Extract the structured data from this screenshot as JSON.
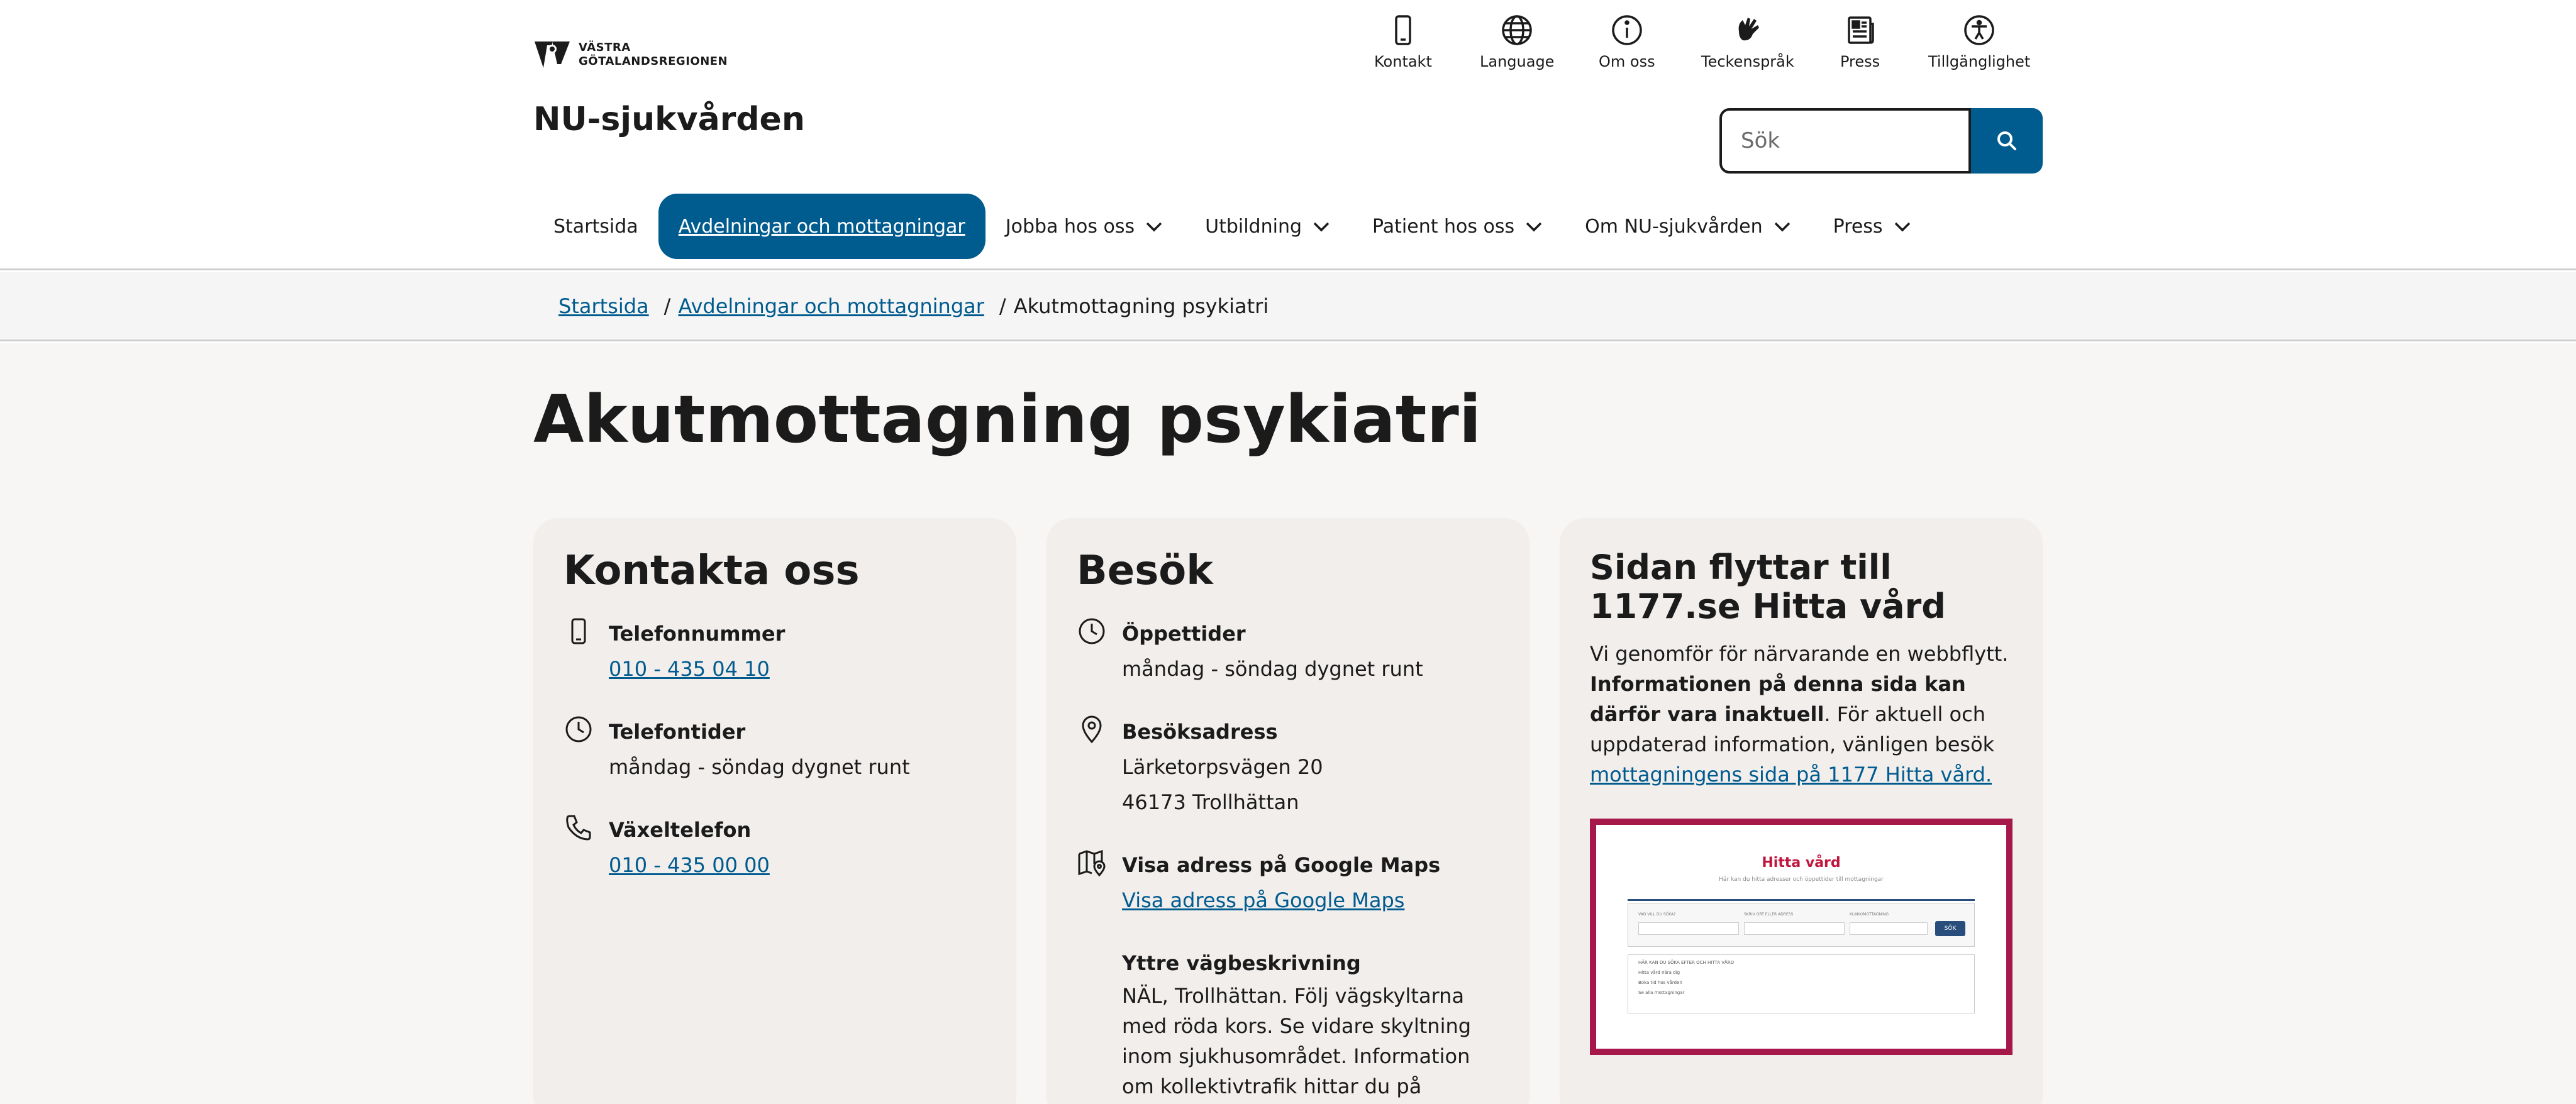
{
  "header": {
    "logo_text_line1": "VÄSTRA",
    "logo_text_line2": "GÖTALANDSREGIONEN",
    "site_title": "NU-sjukvården",
    "utility_links": [
      {
        "label": "Kontakt",
        "icon": "phone-icon"
      },
      {
        "label": "Language",
        "icon": "globe-icon"
      },
      {
        "label": "Om oss",
        "icon": "info-icon"
      },
      {
        "label": "Teckenspråk",
        "icon": "sign-language-icon"
      },
      {
        "label": "Press",
        "icon": "newspaper-icon"
      },
      {
        "label": "Tillgänglighet",
        "icon": "accessibility-icon"
      }
    ],
    "search": {
      "placeholder": "Sök",
      "value": ""
    }
  },
  "nav": [
    {
      "label": "Startsida",
      "has_dropdown": false,
      "active": false
    },
    {
      "label": "Avdelningar och mottagningar",
      "has_dropdown": false,
      "active": true
    },
    {
      "label": "Jobba hos oss",
      "has_dropdown": true,
      "active": false
    },
    {
      "label": "Utbildning",
      "has_dropdown": true,
      "active": false
    },
    {
      "label": "Patient hos oss",
      "has_dropdown": true,
      "active": false
    },
    {
      "label": "Om NU-sjukvården",
      "has_dropdown": true,
      "active": false
    },
    {
      "label": "Press",
      "has_dropdown": true,
      "active": false
    }
  ],
  "breadcrumb": {
    "items": [
      "Startsida",
      "Avdelningar och mottagningar"
    ],
    "separator": "/",
    "current": "Akutmottagning psykiatri"
  },
  "page_title": "Akutmottagning psykiatri",
  "contact_card": {
    "title": "Kontakta oss",
    "phone_label": "Telefonnummer",
    "phone_value": "010 - 435 04 10",
    "hours_label": "Telefontider",
    "hours_value": "måndag - söndag dygnet runt",
    "switchboard_label": "Växeltelefon",
    "switchboard_value": "010 - 435 00 00"
  },
  "visit_card": {
    "title": "Besök",
    "opening_label": "Öppettider",
    "opening_value": "måndag - söndag dygnet runt",
    "address_label": "Besöksadress",
    "address_line1": "Lärketorpsvägen 20",
    "address_line2": "46173 Trollhättan",
    "maps_label": "Visa adress på Google Maps",
    "maps_link": "Visa adress på Google Maps",
    "directions_label": "Yttre vägbeskrivning",
    "directions_text": "NÄL, Trollhättan. Följ vägskyltarna med röda kors. Se vidare skyltning inom sjukhusområdet. Information om kollektivtrafik hittar du på Västtrafiks"
  },
  "move_card": {
    "title": "Sidan flyttar till 1177.se Hitta vård",
    "text_intro": "Vi genomför för närvarande en webbflytt.",
    "text_bold": "Informationen på denna sida kan därför vara inaktuell",
    "text_rest": ". För aktuell och uppdaterad information, vänligen besök",
    "link": "mottagningens sida på 1177 Hitta vård.",
    "preview": {
      "title": "Hitta vård",
      "subtitle": "Här kan du hitta adresser och öppettider till mottagningar",
      "field_labels": [
        "VAD VILL DU SÖKA?",
        "SKRIV ORT ELLER ADRESS",
        "KLINIK/MOTTAGNING"
      ],
      "button": "SÖK",
      "list_items": [
        "HÄR KAN DU SÖKA EFTER OCH HITTA VÅRD",
        "Hitta vård nära dig",
        "Boka tid hos vården",
        "Se alla mottagningar"
      ]
    }
  },
  "colors": {
    "brand_blue": "#005b8f",
    "preview_border": "#a6174a",
    "card_bg": "#f1eeec"
  }
}
